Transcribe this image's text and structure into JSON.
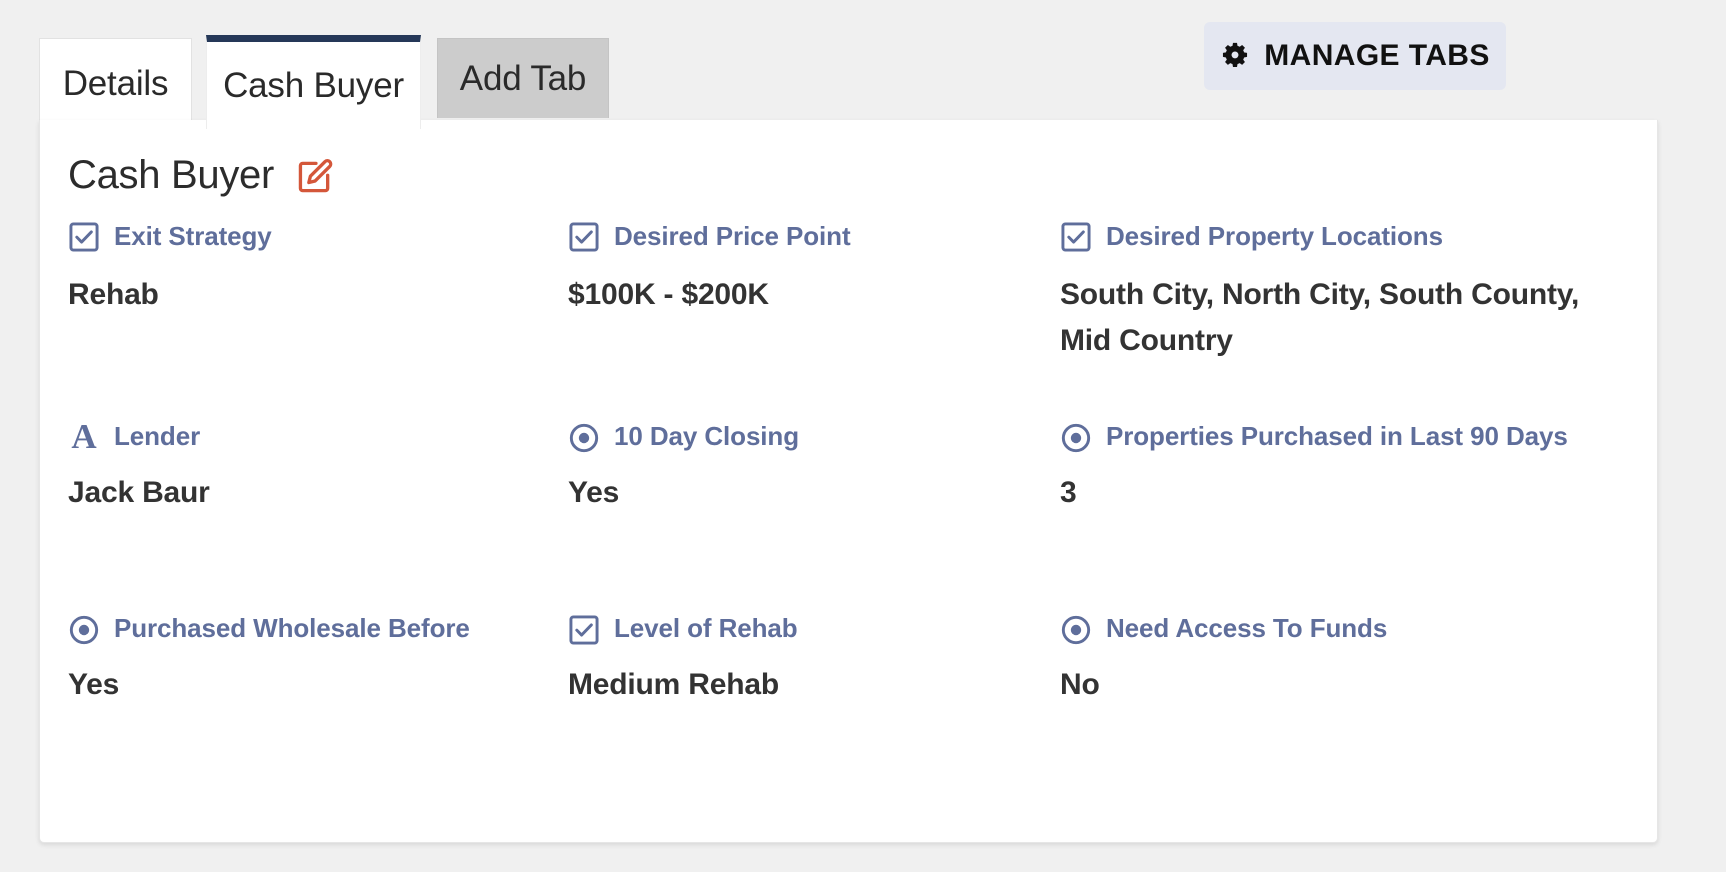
{
  "tabs": [
    {
      "label": "Details",
      "active": false,
      "name": "tab-details"
    },
    {
      "label": "Cash Buyer",
      "active": true,
      "name": "tab-cash-buyer"
    },
    {
      "label": "Add Tab",
      "active": false,
      "name": "tab-add"
    }
  ],
  "toolbar": {
    "manage_tabs_label": "MANAGE TABS",
    "gear_icon": "gear-icon",
    "button_bg": "#e4e7f1"
  },
  "card": {
    "title": "Cash Buyer",
    "edit_icon": "edit-pencil-icon",
    "edit_icon_color": "#d4573a",
    "label_color": "#5f6e9b",
    "value_color": "#333333",
    "active_tab_accent": "#253858"
  },
  "fields": {
    "row1": [
      {
        "icon": "checkbox-checked-icon",
        "label": "Exit Strategy",
        "value": "Rehab"
      },
      {
        "icon": "checkbox-checked-icon",
        "label": "Desired Price Point",
        "value": "$100K - $200K"
      },
      {
        "icon": "checkbox-checked-icon",
        "label": "Desired Property Locations",
        "value": "South City, North City, South County, Mid Country"
      }
    ],
    "row2": [
      {
        "icon": "text-field-icon",
        "icon_glyph": "A",
        "label": "Lender",
        "value": "Jack Baur"
      },
      {
        "icon": "radio-selected-icon",
        "label": "10 Day Closing",
        "value": "Yes"
      },
      {
        "icon": "radio-selected-icon",
        "label": "Properties Purchased in Last 90 Days",
        "value": "3"
      }
    ],
    "row3": [
      {
        "icon": "radio-selected-icon",
        "label": "Purchased Wholesale Before",
        "value": "Yes"
      },
      {
        "icon": "checkbox-checked-icon",
        "label": "Level of Rehab",
        "value": "Medium Rehab"
      },
      {
        "icon": "radio-selected-icon",
        "label": "Need Access To Funds",
        "value": "No"
      }
    ]
  }
}
